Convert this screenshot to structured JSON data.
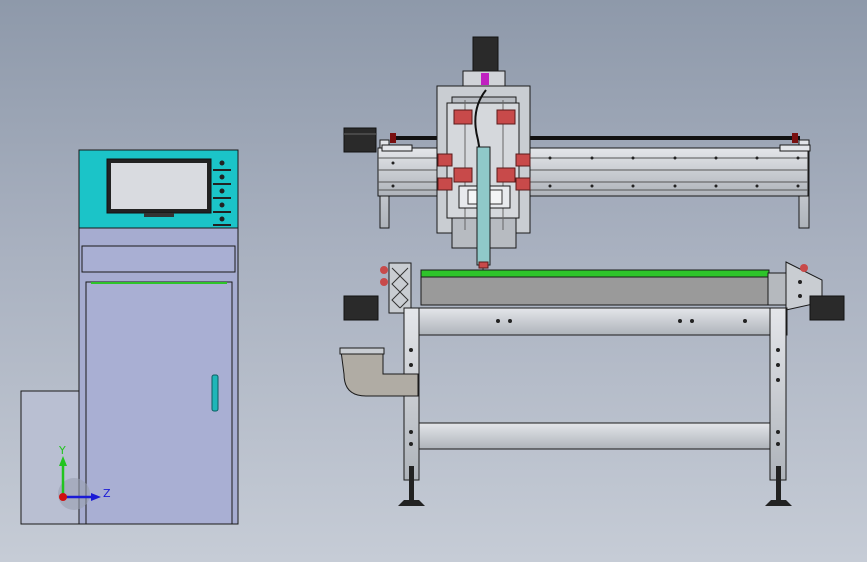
{
  "viewport": {
    "background_top": "#8e99aa",
    "background_bottom": "#c6ccd6"
  },
  "triad": {
    "y_label": "Y",
    "z_label": "Z",
    "y_color": "#22c41e",
    "z_color": "#1b1bd6",
    "origin_color": "#d01010"
  },
  "colors": {
    "panel_cyan": "#1bc4c8",
    "cabinet_body": "#a3a9cf",
    "screen": "#d9dbe0",
    "handle": "#1fb6b8",
    "steel": "#c9cdd2",
    "bed_green": "#2ec42a",
    "bed_gray": "#9a9a9a",
    "bearing_red": "#c84a4a",
    "outline": "#1a1a1a"
  },
  "icons": {
    "triad": "coordinate-triad-icon"
  }
}
